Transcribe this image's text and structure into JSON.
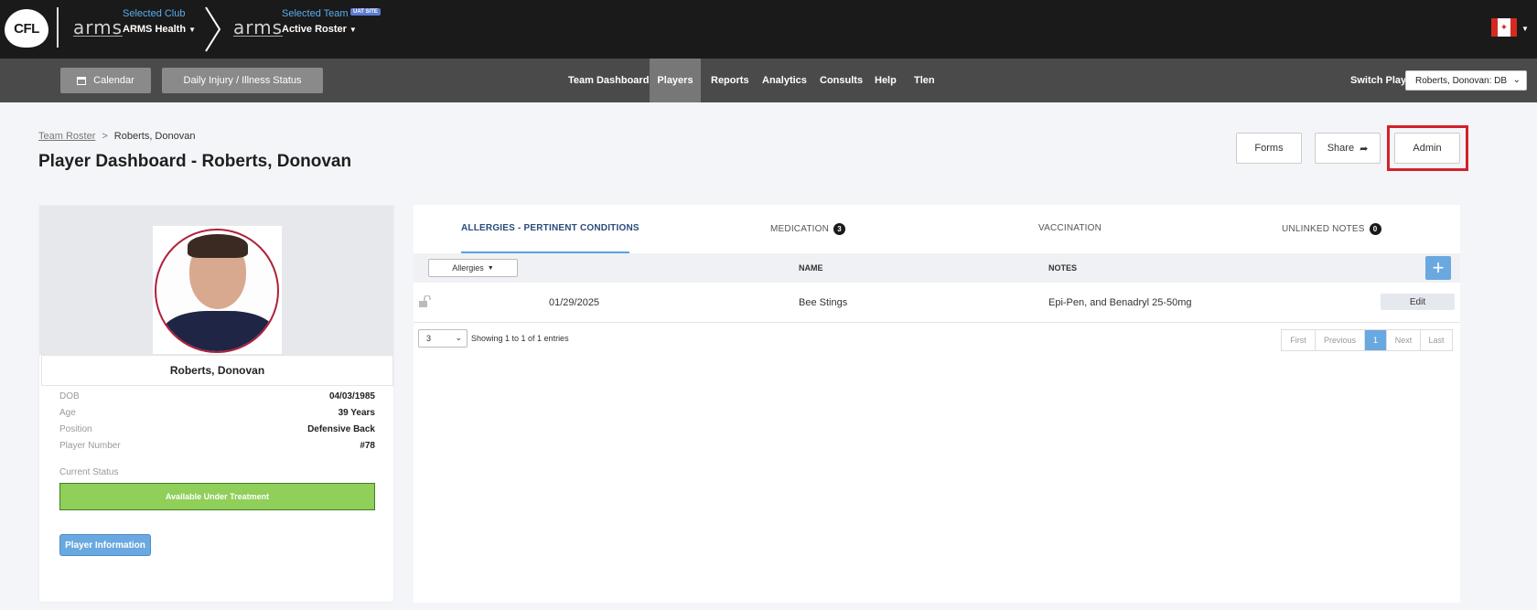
{
  "logo": {
    "text": "CFL"
  },
  "club": {
    "brand": "arms",
    "label": "Selected Club",
    "value": "ARMS Health"
  },
  "team": {
    "brand": "arms",
    "label": "Selected Team",
    "badge": "UAT SITE",
    "value": "Active Roster"
  },
  "toolbar": {
    "calendar_label": "Calendar",
    "daily_status_label": "Daily Injury / Illness Status"
  },
  "nav": {
    "items": [
      "Team Dashboard",
      "Players",
      "Reports",
      "Analytics",
      "Consults",
      "Help",
      "Tlen"
    ],
    "active": "Players",
    "switch_label": "Switch Player",
    "switch_value": "Roberts, Donovan: DB"
  },
  "breadcrumb": {
    "root": "Team Roster",
    "separator": ">",
    "current": "Roberts, Donovan"
  },
  "page_title": "Player Dashboard - Roberts, Donovan",
  "actions": {
    "forms": "Forms",
    "share": "Share",
    "admin": "Admin"
  },
  "player": {
    "name": "Roberts, Donovan",
    "fields": [
      {
        "label": "DOB",
        "value": "04/03/1985"
      },
      {
        "label": "Age",
        "value": "39 Years"
      },
      {
        "label": "Position",
        "value": "Defensive Back"
      },
      {
        "label": "Player Number",
        "value": "#78"
      }
    ],
    "status_label": "Current Status",
    "status_value": "Available Under Treatment",
    "status_color": "#8fcf5a",
    "info_button": "Player Information"
  },
  "tabs": [
    {
      "label": "ALLERGIES - PERTINENT CONDITIONS",
      "badge": ""
    },
    {
      "label": "MEDICATION",
      "badge": "3"
    },
    {
      "label": "VACCINATION",
      "badge": ""
    },
    {
      "label": "UNLINKED NOTES",
      "badge": "0"
    }
  ],
  "table": {
    "filter_label": "Allergies",
    "headers": {
      "name": "NAME",
      "notes": "NOTES"
    },
    "rows": [
      {
        "date": "01/29/2025",
        "name": "Bee Stings",
        "notes": "Epi-Pen, and Benadryl 25-50mg",
        "action": "Edit",
        "icon": "unlock-icon"
      }
    ],
    "page_size": "3",
    "entries_text": "Showing 1 to 1 of 1 entries",
    "pager": {
      "first": "First",
      "previous": "Previous",
      "current": "1",
      "next": "Next",
      "last": "Last"
    }
  },
  "colors": {
    "accent": "#6aa8e0",
    "highlight": "#d3212c",
    "topbar": "#1a1a1a",
    "navbar": "#4a4a4a"
  }
}
